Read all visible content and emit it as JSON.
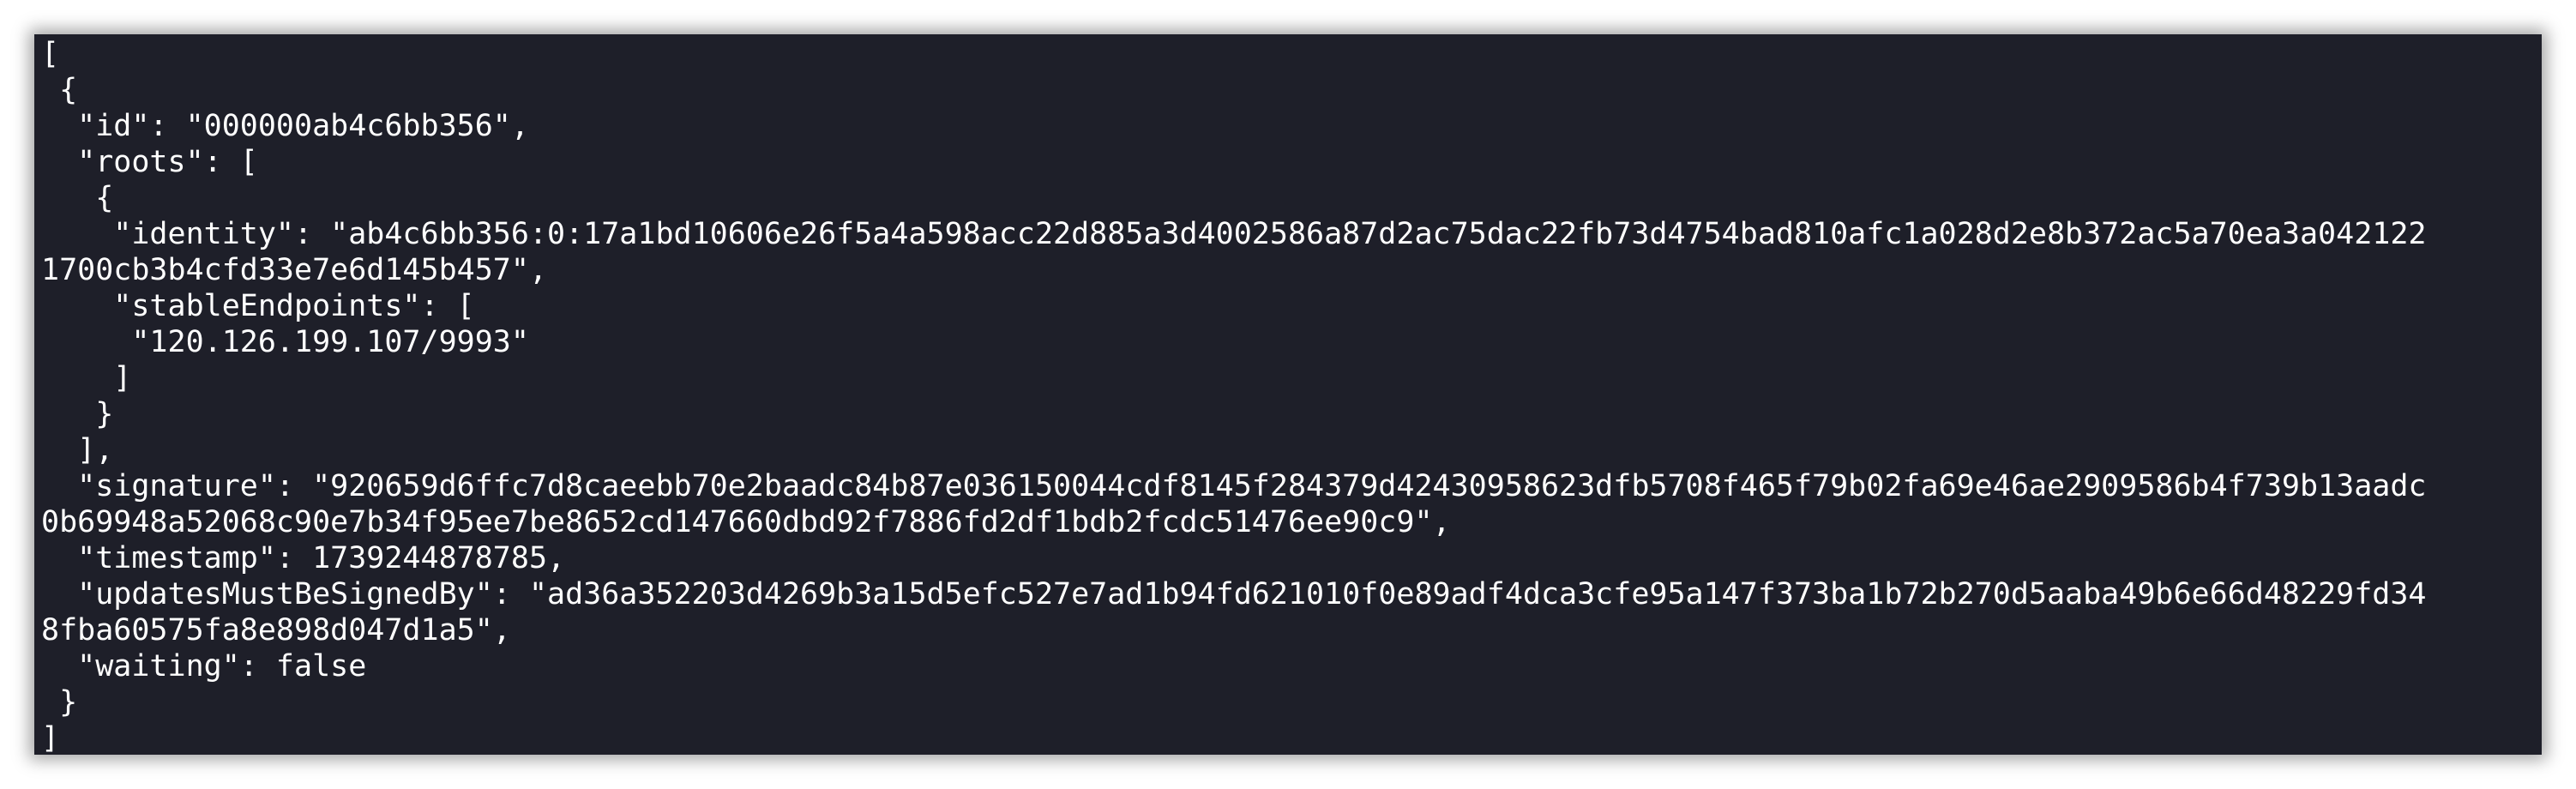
{
  "terminal": {
    "lines": [
      "[",
      " {",
      "  \"id\": \"000000ab4c6bb356\",",
      "  \"roots\": [",
      "   {",
      "    \"identity\": \"ab4c6bb356:0:17a1bd10606e26f5a4a598acc22d885a3d4002586a87d2ac75dac22fb73d4754bad810afc1a028d2e8b372ac5a70ea3a042122",
      "1700cb3b4cfd33e7e6d145b457\",",
      "    \"stableEndpoints\": [",
      "     \"120.126.199.107/9993\"",
      "    ]",
      "   }",
      "  ],",
      "  \"signature\": \"920659d6ffc7d8caeebb70e2baadc84b87e036150044cdf8145f284379d42430958623dfb5708f465f79b02fa69e46ae2909586b4f739b13aadc",
      "0b69948a52068c90e7b34f95ee7be8652cd147660dbd92f7886fd2df1bdb2fcdc51476ee90c9\",",
      "  \"timestamp\": 1739244878785,",
      "  \"updatesMustBeSignedBy\": \"ad36a352203d4269b3a15d5efc527e7ad1b94fd621010f0e89adf4dca3cfe95a147f373ba1b72b270d5aaba49b6e66d48229fd34",
      "8fba60575fa8e898d047d1a5\",",
      "  \"waiting\": false",
      " }",
      "]"
    ]
  }
}
